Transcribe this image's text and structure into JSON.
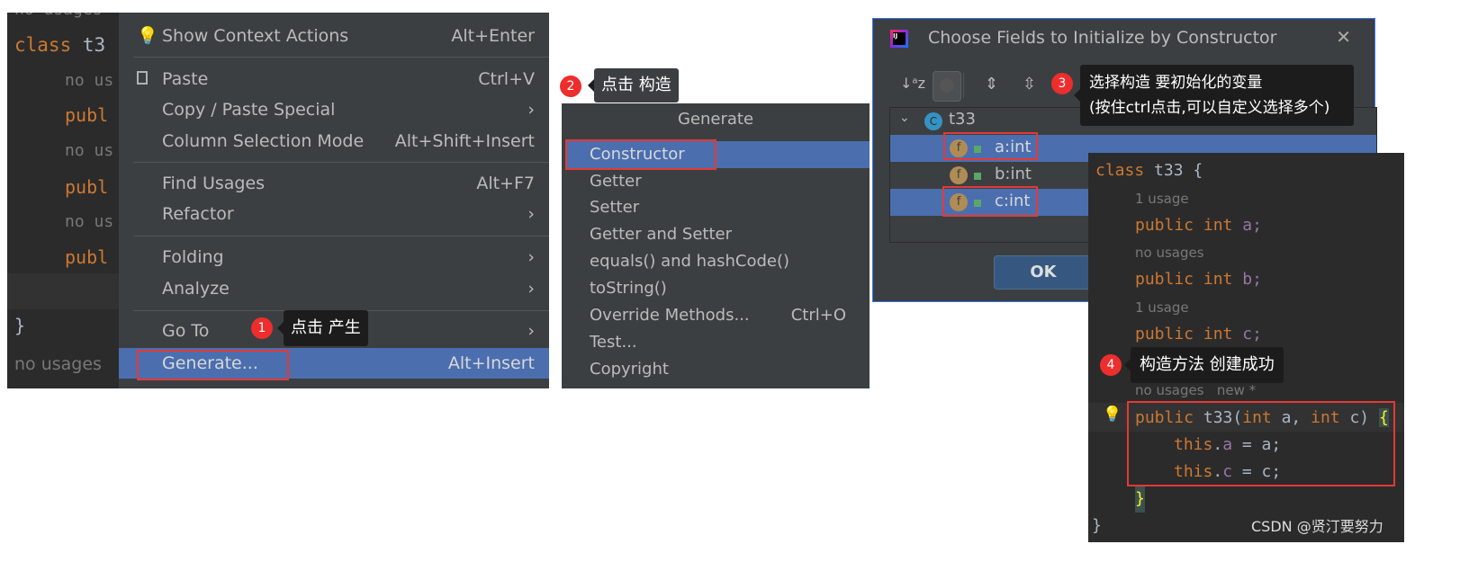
{
  "left_editor": {
    "lines": [
      "no usages",
      "class t3",
      "no us",
      "publ",
      "no us",
      "publ",
      "no us",
      "publ",
      "}",
      "no usages"
    ]
  },
  "context_menu": {
    "items": [
      {
        "label": "Show Context Actions",
        "shortcut": "Alt+Enter",
        "icon": "lightbulb-icon"
      },
      {
        "label": "Paste",
        "shortcut": "Ctrl+V",
        "icon": "clipboard-icon"
      },
      {
        "label": "Copy / Paste Special",
        "submenu": true
      },
      {
        "label": "Column Selection Mode",
        "shortcut": "Alt+Shift+Insert"
      },
      {
        "label": "Find Usages",
        "shortcut": "Alt+F7"
      },
      {
        "label": "Refactor",
        "submenu": true
      },
      {
        "label": "Folding",
        "submenu": true
      },
      {
        "label": "Analyze",
        "submenu": true
      },
      {
        "label": "Go To",
        "submenu": true
      },
      {
        "label": "Generate...",
        "shortcut": "Alt+Insert",
        "selected": true
      }
    ]
  },
  "step1": {
    "num": "1",
    "text": "点击 产生"
  },
  "generate_popup": {
    "title": "Generate",
    "items": [
      {
        "label": "Constructor",
        "selected": true
      },
      {
        "label": "Getter"
      },
      {
        "label": "Setter"
      },
      {
        "label": "Getter and Setter"
      },
      {
        "label": "equals() and hashCode()"
      },
      {
        "label": "toString()"
      },
      {
        "label": "Override Methods...",
        "shortcut": "Ctrl+O"
      },
      {
        "label": "Test..."
      },
      {
        "label": "Copyright"
      }
    ]
  },
  "step2": {
    "num": "2",
    "text": "点击 构造"
  },
  "dialog": {
    "title": "Choose Fields to Initialize by Constructor",
    "class_name": "t33",
    "class_icon": "C",
    "fields": [
      {
        "label": "a:int",
        "selected": true
      },
      {
        "label": "b:int",
        "selected": false
      },
      {
        "label": "c:int",
        "selected": true
      }
    ],
    "ok": "OK",
    "field_icon": "f"
  },
  "step3": {
    "num": "3",
    "line1": "选择构造 要初始化的变量",
    "line2": "(按住ctrl点击,可以自定义选择多个)"
  },
  "result_code": {
    "class_kw": "class",
    "class_name": "t33 {",
    "usage1": "1 usage",
    "field_a": "a;",
    "usage2": "no usages",
    "field_b": "b;",
    "usage3": "1 usage",
    "field_c": "c;",
    "usage4": "no usages",
    "new_tag": "new *",
    "public": "public",
    "int": "int",
    "ctor_name": "t33(",
    "ctor_p1": "int",
    "ctor_a": " a, ",
    "ctor_p2": "int",
    "ctor_c": " c) ",
    "brace_open": "{",
    "this": "this",
    "assign_a": " = a;",
    "assign_c": " = c;",
    "a": "a",
    "c": "c",
    "brace_close": "}",
    "class_close": "}"
  },
  "step4": {
    "num": "4",
    "text": "构造方法 创建成功"
  },
  "watermark": "CSDN @贤汀要努力",
  "colors": {
    "selection": "#4b6eaf",
    "highlight_box": "#e53935",
    "keyword": "#cc7832",
    "field": "#9876aa"
  }
}
